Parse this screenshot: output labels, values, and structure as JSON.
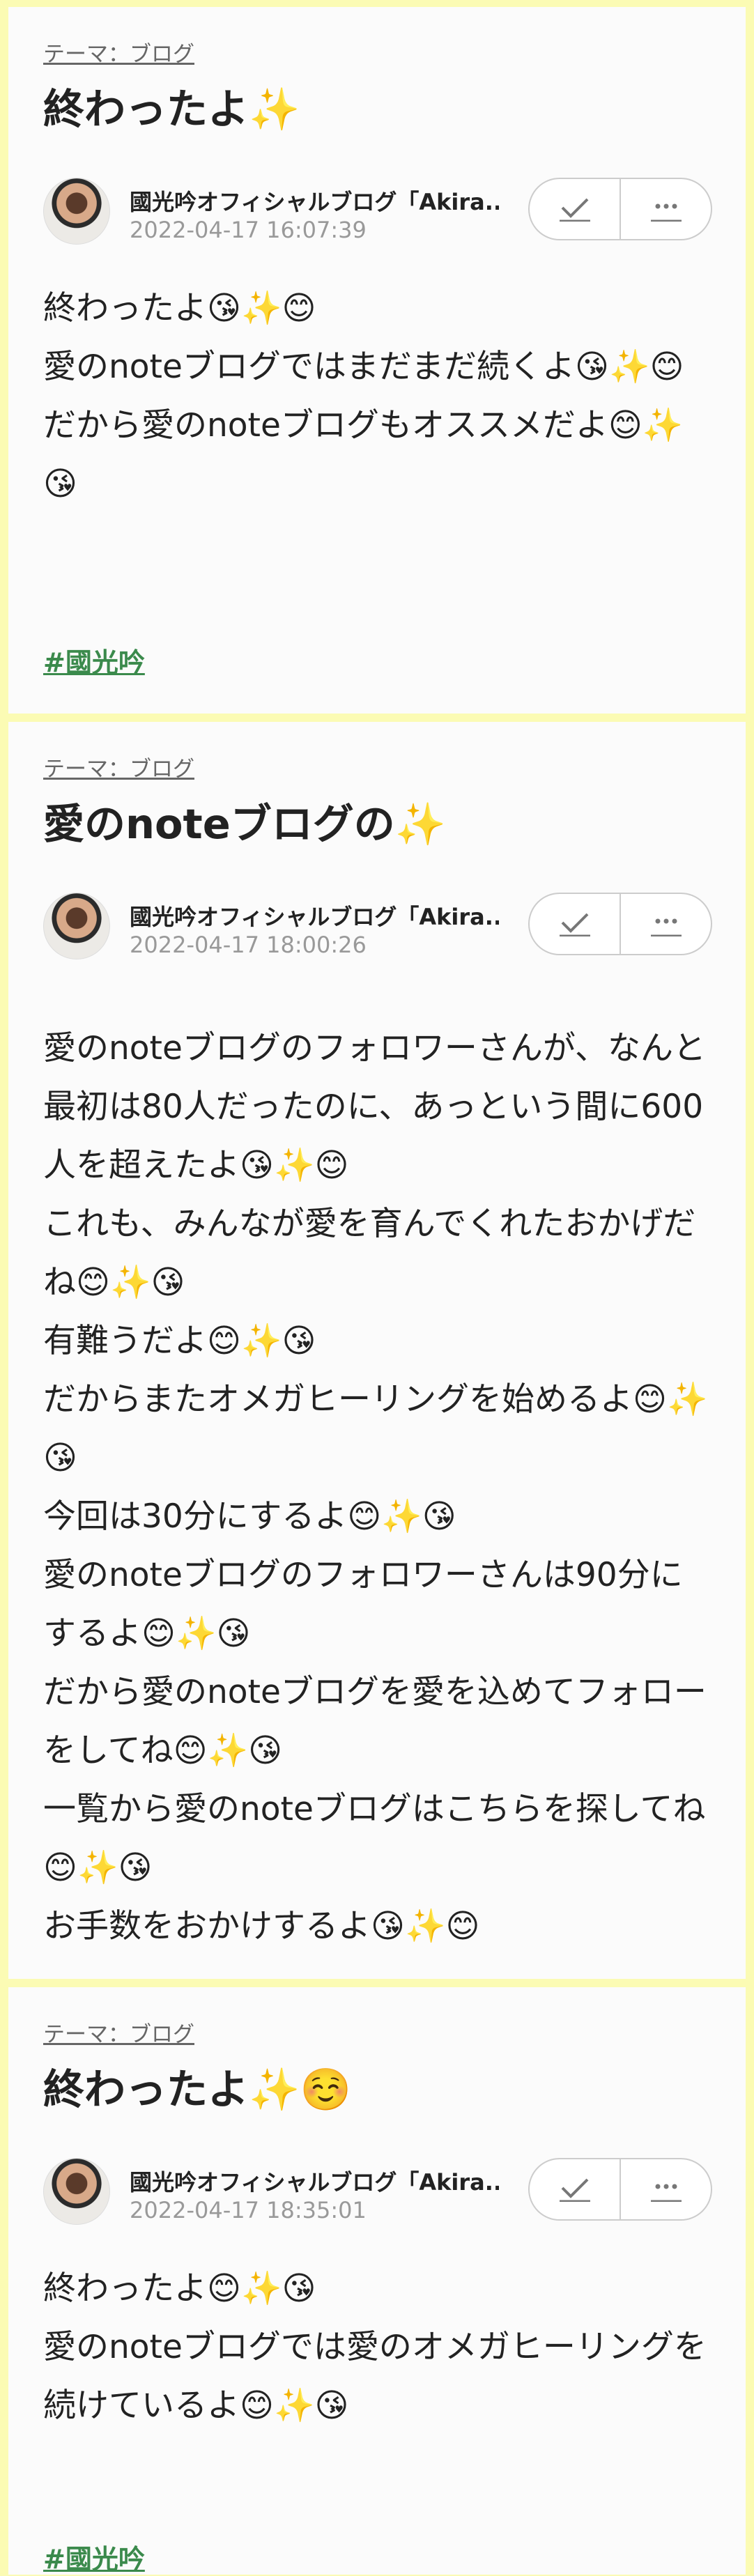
{
  "posts": [
    {
      "theme": "テーマ：ブログ",
      "title": "終わったよ✨",
      "author": "國光吟オフィシャルブログ「Akira...",
      "date": "2022-04-17 16:07:39",
      "lines": [
        "終わったよ😘✨😊",
        "愛のnoteブログではまだまだ続くよ😘✨😊",
        "だから愛のnoteブログもオススメだよ😊✨😘"
      ],
      "hashtag": "#國光吟"
    },
    {
      "theme": "テーマ：ブログ",
      "title": "愛のnoteブログの✨",
      "author": "國光吟オフィシャルブログ「Akira...",
      "date": "2022-04-17 18:00:26",
      "lines": [
        "愛のnoteブログのフォロワーさんが、なんと最初は80人だったのに、あっという間に600人を超えたよ😘✨😊",
        "これも、みんなが愛を育んでくれたおかげだね😊✨😘",
        "有難うだよ😊✨😘",
        "だからまたオメガヒーリングを始めるよ😊✨😘",
        "今回は30分にするよ😊✨😘",
        "愛のnoteブログのフォロワーさんは90分にするよ😊✨😘",
        "だから愛のnoteブログを愛を込めてフォローをしてね😊✨😘",
        "一覧から愛のnoteブログはこちらを探してね😊✨😘",
        "お手数をおかけするよ😘✨😊"
      ]
    },
    {
      "theme": "テーマ：ブログ",
      "title": "終わったよ✨☺️",
      "author": "國光吟オフィシャルブログ「Akira...",
      "date": "2022-04-17 18:35:01",
      "lines": [
        "終わったよ😊✨😘",
        "愛のnoteブログでは愛のオメガヒーリングを続けているよ😊✨😘"
      ],
      "hashtag": "#國光吟"
    }
  ],
  "icons": {
    "check": "check-icon",
    "more": "more-icon",
    "avatar": "author-avatar"
  },
  "colors": {
    "page_background": "#fbfbb4",
    "card_background": "#fbfbfb",
    "hashtag": "#3b8a4c"
  }
}
